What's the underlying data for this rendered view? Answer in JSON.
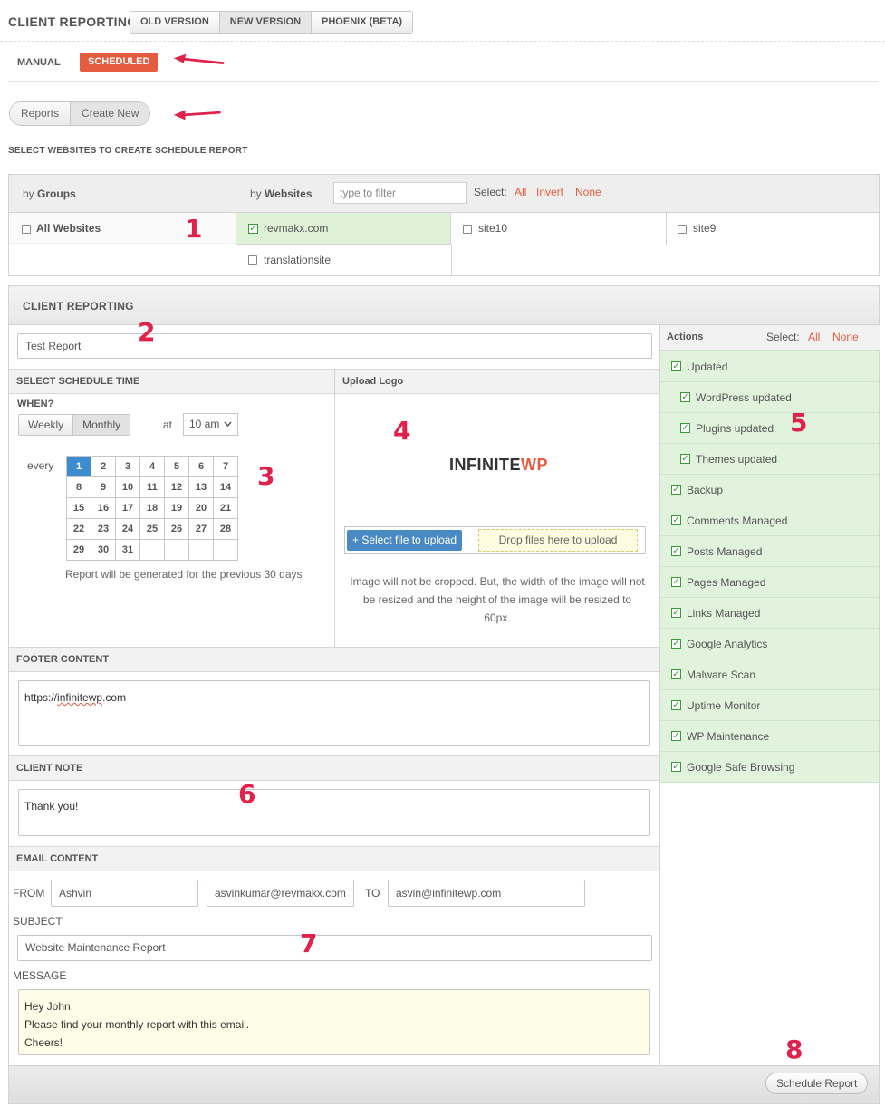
{
  "header": {
    "title": "CLIENT REPORTING",
    "version_tabs": [
      {
        "label": "OLD VERSION"
      },
      {
        "label": "NEW VERSION"
      },
      {
        "label": "PHOENIX (BETA)"
      }
    ]
  },
  "mode_tabs": {
    "manual": "MANUAL",
    "scheduled": "SCHEDULED"
  },
  "view_toggle": {
    "reports": "Reports",
    "create_new": "Create New"
  },
  "select_title": "SELECT WEBSITES TO CREATE SCHEDULE REPORT",
  "websites_table": {
    "by": "by",
    "groups": "Groups",
    "websites": "Websites",
    "filter_placeholder": "type to filter",
    "select_label": "Select:",
    "select_all": "All",
    "select_invert": "Invert",
    "select_none": "None",
    "all_websites": "All Websites",
    "sites": [
      "revmakx.com",
      "site10",
      "site9",
      "translationsite"
    ]
  },
  "annotations": [
    "1",
    "2",
    "3",
    "4",
    "5",
    "6",
    "7",
    "8"
  ],
  "client_reporting": {
    "title": "CLIENT REPORTING",
    "report_name": "Test Report",
    "schedule_title": "SELECT SCHEDULE TIME",
    "when": "WHEN?",
    "weekly": "Weekly",
    "monthly": "Monthly",
    "at": "at",
    "time": "10 am",
    "every": "every",
    "days": [
      "1",
      "2",
      "3",
      "4",
      "5",
      "6",
      "7",
      "8",
      "9",
      "10",
      "11",
      "12",
      "13",
      "14",
      "15",
      "16",
      "17",
      "18",
      "19",
      "20",
      "21",
      "22",
      "23",
      "24",
      "25",
      "26",
      "27",
      "28",
      "29",
      "30",
      "31"
    ],
    "selected_day": 1,
    "report_note": "Report will be generated for the previous 30 days",
    "upload_title": "Upload Logo",
    "logo_main": "INFINITE",
    "logo_accent": "WP",
    "select_file": "+ Select file to upload",
    "drop_files": "Drop files here to upload",
    "image_note": "Image will not be cropped. But, the width of the image will not be resized and the height of the image will be resized to 60px.",
    "footer_title": "FOOTER CONTENT",
    "footer_prefix": "https://",
    "footer_word": "infinitewp",
    "footer_suffix": ".com",
    "client_note_title": "CLIENT NOTE",
    "client_note": "Thank you!",
    "email_title": "EMAIL CONTENT",
    "from_label": "FROM",
    "from_name": "Ashvin",
    "from_email": "asvinkumar@revmakx.com",
    "to_label": "TO",
    "to_email": "asvin@infinitewp.com",
    "subject_label": "SUBJECT",
    "subject": "Website Maintenance Report",
    "message_label": "MESSAGE",
    "message_lines": [
      "Hey John,",
      "Please find your monthly report with this email.",
      "Cheers!"
    ],
    "schedule_button": "Schedule Report"
  },
  "actions": {
    "title": "Actions",
    "select_label": "Select:",
    "select_all": "All",
    "select_none": "None",
    "items": [
      {
        "label": "Updated",
        "indent": false
      },
      {
        "label": "WordPress updated",
        "indent": true
      },
      {
        "label": "Plugins updated",
        "indent": true
      },
      {
        "label": "Themes updated",
        "indent": true
      },
      {
        "label": "Backup",
        "indent": false
      },
      {
        "label": "Comments Managed",
        "indent": false
      },
      {
        "label": "Posts Managed",
        "indent": false
      },
      {
        "label": "Pages Managed",
        "indent": false
      },
      {
        "label": "Links Managed",
        "indent": false
      },
      {
        "label": "Google Analytics",
        "indent": false
      },
      {
        "label": "Malware Scan",
        "indent": false
      },
      {
        "label": "Uptime Monitor",
        "indent": false
      },
      {
        "label": "WP Maintenance",
        "indent": false
      },
      {
        "label": "Google Safe Browsing",
        "indent": false
      }
    ]
  },
  "colors": {
    "accent": "#e55b3f",
    "annotation": "#e0214b",
    "selected_day": "#3e8cd0",
    "action_bg": "#e1f3dc"
  }
}
